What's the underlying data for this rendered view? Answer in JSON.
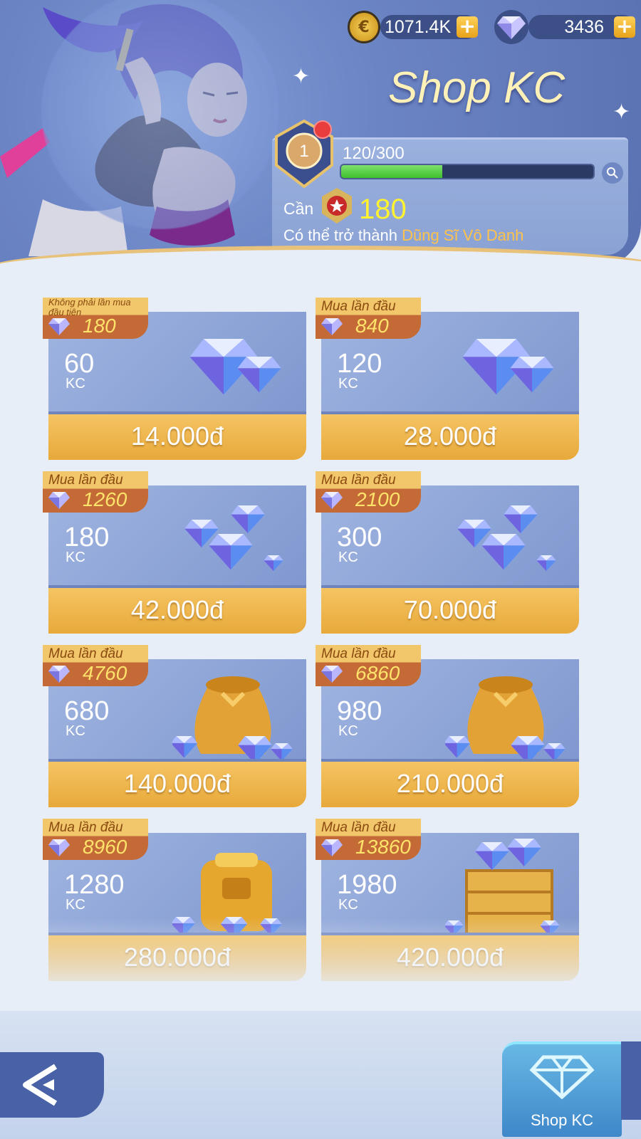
{
  "header": {
    "coins_value": "1071.4K",
    "gems_value": "3436",
    "title": "Shop KC",
    "rank_number": "1",
    "progress_text": "120/300",
    "progress_fraction": 0.4,
    "need_label": "Cần",
    "need_value": "180",
    "become_prefix": "Có thể trở thành",
    "become_rank": "Dũng Sĩ Vô Danh"
  },
  "packs": [
    {
      "ribbon": "Không phải lần mua đầu tiên",
      "bonus": "180",
      "amount": "60",
      "unit": "KC",
      "price": "14.000đ",
      "art": "gems-small"
    },
    {
      "ribbon": "Mua lần đầu",
      "bonus": "840",
      "amount": "120",
      "unit": "KC",
      "price": "28.000đ",
      "art": "gems-small"
    },
    {
      "ribbon": "Mua lần đầu",
      "bonus": "1260",
      "amount": "180",
      "unit": "KC",
      "price": "42.000đ",
      "art": "gems-pile"
    },
    {
      "ribbon": "Mua lần đầu",
      "bonus": "2100",
      "amount": "300",
      "unit": "KC",
      "price": "70.000đ",
      "art": "gems-pile"
    },
    {
      "ribbon": "Mua lần đầu",
      "bonus": "4760",
      "amount": "680",
      "unit": "KC",
      "price": "140.000đ",
      "art": "gem-bag"
    },
    {
      "ribbon": "Mua lần đầu",
      "bonus": "6860",
      "amount": "980",
      "unit": "KC",
      "price": "210.000đ",
      "art": "gem-bag"
    },
    {
      "ribbon": "Mua lần đầu",
      "bonus": "8960",
      "amount": "1280",
      "unit": "KC",
      "price": "280.000đ",
      "art": "gem-backpack"
    },
    {
      "ribbon": "Mua lần đầu",
      "bonus": "13860",
      "amount": "1980",
      "unit": "KC",
      "price": "420.000đ",
      "art": "gem-crate"
    }
  ],
  "bottom": {
    "shop_tab_label": "Shop KC"
  },
  "icons": [
    "coin-icon",
    "gem-icon",
    "plus-icon",
    "rank-badge-icon",
    "search-icon",
    "honor-badge-icon",
    "back-arrow-icon"
  ],
  "colors": {
    "accent_gold": "#e8a93a",
    "panel_blue": "#7f97cf",
    "progress_green": "#3fbf2d",
    "rank_text": "#ffc24a",
    "need_value": "#fff230"
  }
}
